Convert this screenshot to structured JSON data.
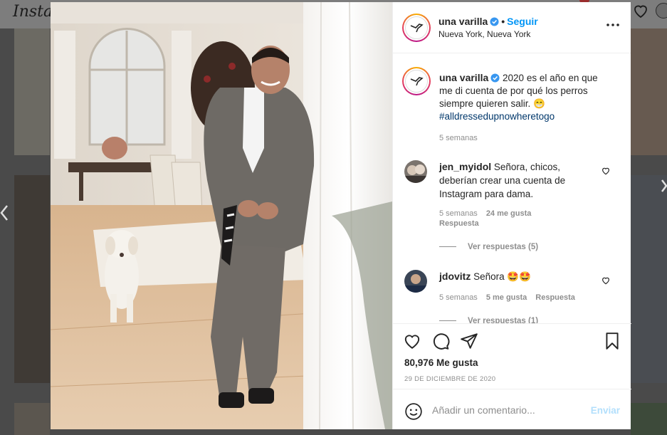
{
  "app": {
    "logo": "Insta",
    "accent": "#0095f6"
  },
  "post": {
    "username": "una varilla",
    "separator": "•",
    "follow_label": "Seguir",
    "location": "Nueva York, Nueva York",
    "more_icon": "more-horizontal-icon",
    "caption_text": "2020 es el año en que me di cuenta de por qué los perros siempre quieren salir. 😁",
    "hashtag": "#alldressedupnowheretogo",
    "caption_time": "5 semanas",
    "likes": "80,976 Me gusta",
    "date": "29 DE DICIEMBRE DE 2020"
  },
  "comments": [
    {
      "username": "jen_myidol",
      "text": "Señora, chicos, deberían crear una cuenta de Instagram para dama.",
      "time": "5 semanas",
      "likes": "24 me gusta",
      "reply_label": "Respuesta",
      "view_replies": "Ver respuestas (5)"
    },
    {
      "username": "jdovitz",
      "text": "Señora 🤩🤩",
      "time": "5 semanas",
      "likes": "5 me gusta",
      "reply_label": "Respuesta",
      "view_replies": "Ver respuestas (1)"
    }
  ],
  "add_comment": {
    "placeholder": "Añadir un comentario...",
    "post_label": "Enviar"
  },
  "icons": [
    "heart-icon",
    "comment-icon",
    "share-icon",
    "bookmark-icon",
    "emoji-icon",
    "verified-icon",
    "chevron-left-icon",
    "chevron-right-icon"
  ]
}
